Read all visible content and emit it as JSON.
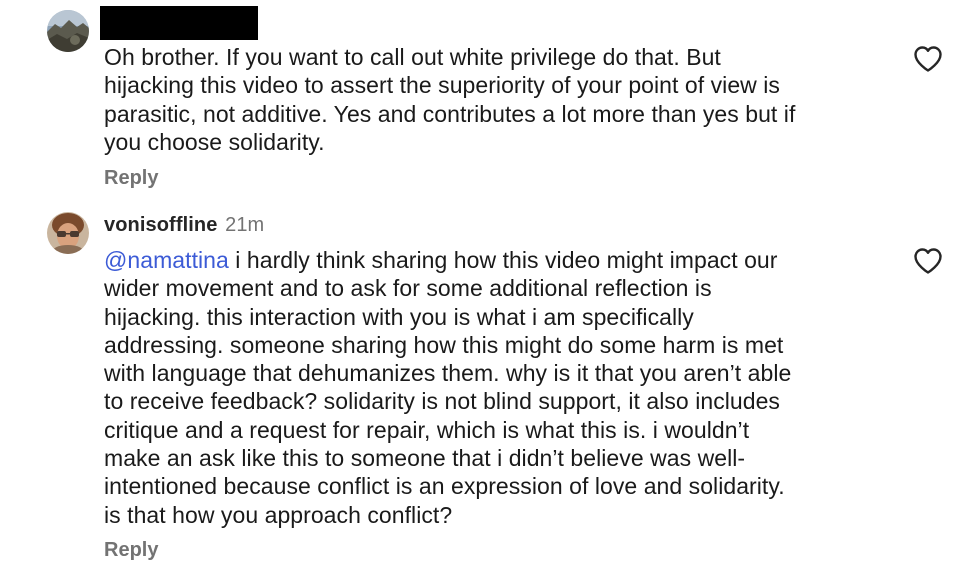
{
  "comments": [
    {
      "username": "",
      "username_redacted": true,
      "avatar": "landscape-avatar",
      "lines": [
        "Oh brother. If you want to call out white privilege do that. But",
        "hijacking this video to assert the superiority of your point of view is",
        "parasitic, not additive. Yes and contributes a lot more than yes but if",
        "you choose solidarity."
      ],
      "reply_label": "Reply",
      "like_icon": "heart-outline-icon"
    },
    {
      "username": "vonisoffline",
      "timestamp": "21m",
      "avatar": "person-avatar",
      "mention": "@namattina",
      "lines": [
        " i hardly think sharing how this video might impact our",
        "wider movement and to ask for some additional reflection is",
        "hijacking. this interaction with you is what i am specifically",
        "addressing. someone sharing how this might do some harm is met",
        "with language that dehumanizes them. why is it that you aren’t able",
        "to receive feedback? solidarity is not blind support, it also includes",
        "critique and a request for repair, which is what this is. i wouldn’t",
        "make an ask like this to someone that i didn’t believe was well-",
        "intentioned because conflict is an expression of love and solidarity.",
        "is that how you approach conflict?"
      ],
      "reply_label": "Reply",
      "like_icon": "heart-outline-icon"
    }
  ],
  "colors": {
    "mention": "#3c5bd6",
    "muted": "#737373",
    "text": "#1a1a1a"
  }
}
